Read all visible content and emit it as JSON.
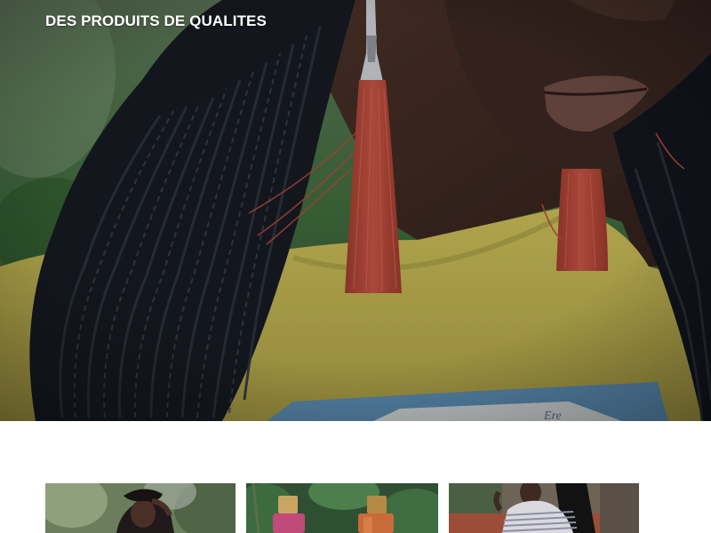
{
  "hero": {
    "title": "DES PRODUITS DE QUALITES",
    "image": "woman-red-tassel-earrings-photo"
  },
  "products": [
    {
      "image": "woman-leaning-foliage-photo"
    },
    {
      "image": "perfume-bottles-foliage-photo"
    },
    {
      "image": "woman-striped-shirt-photo"
    }
  ],
  "colors": {
    "background": "#ffffff",
    "title": "#ffffff",
    "tassel": "#b8483a",
    "shirt": "#bdb04e",
    "skin": "#3e2a24"
  }
}
